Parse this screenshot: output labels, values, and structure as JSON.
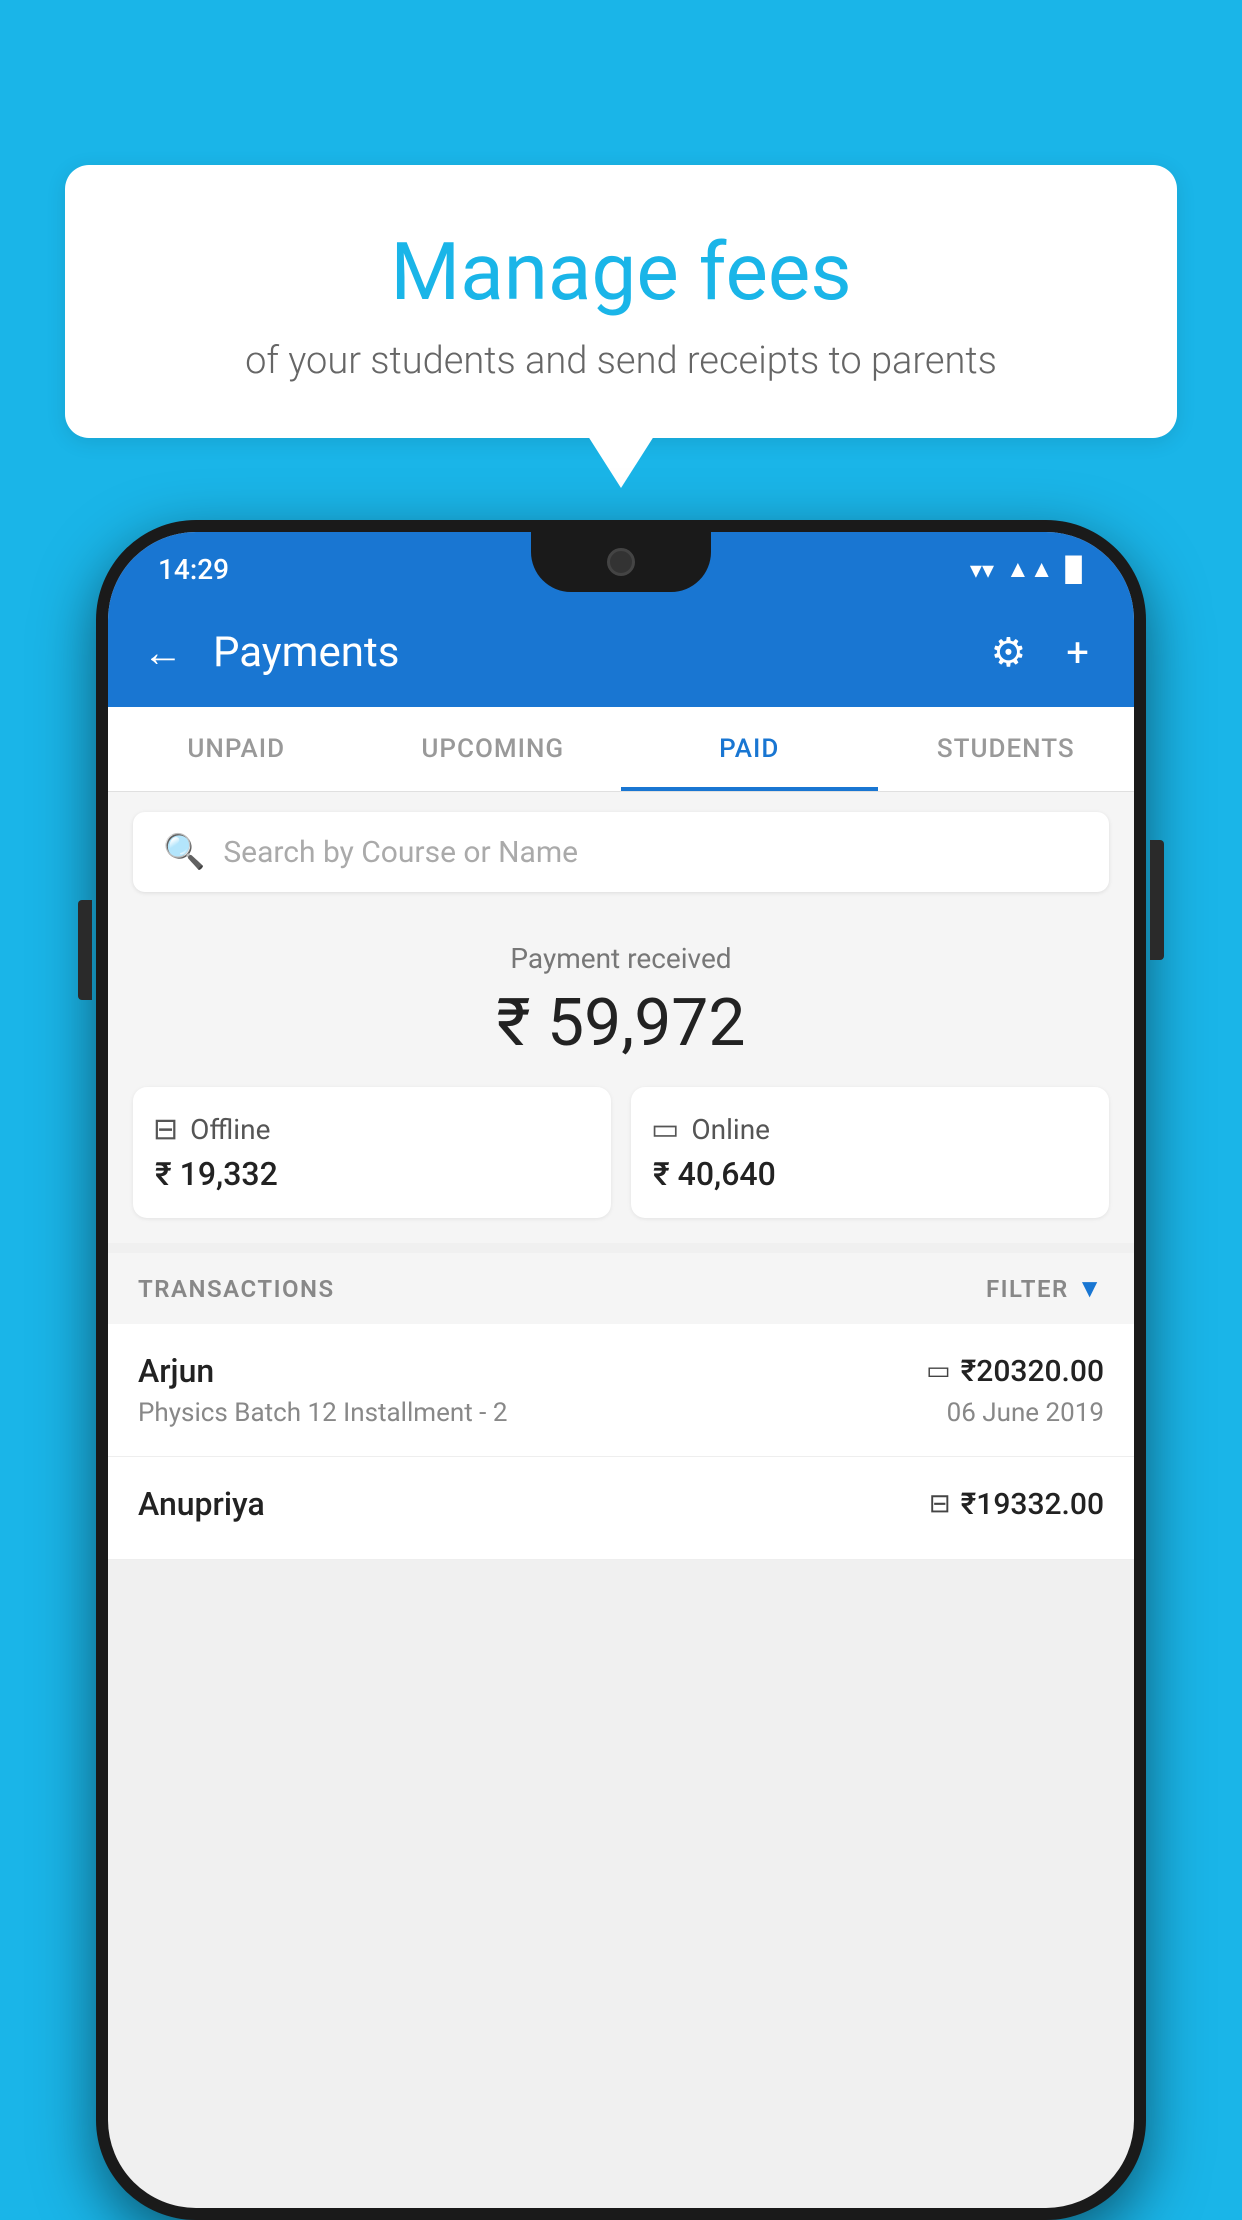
{
  "background_color": "#1ab5e8",
  "bubble": {
    "title": "Manage fees",
    "subtitle": "of your students and send receipts to parents"
  },
  "phone": {
    "status_bar": {
      "time": "14:29",
      "wifi": "▲",
      "signal": "▲",
      "battery": "▉"
    },
    "app_bar": {
      "title": "Payments",
      "back_label": "←",
      "gear_label": "⚙",
      "plus_label": "+"
    },
    "tabs": [
      {
        "label": "UNPAID",
        "active": false
      },
      {
        "label": "UPCOMING",
        "active": false
      },
      {
        "label": "PAID",
        "active": true
      },
      {
        "label": "STUDENTS",
        "active": false
      }
    ],
    "search": {
      "placeholder": "Search by Course or Name"
    },
    "payment_summary": {
      "label": "Payment received",
      "total": "₹ 59,972",
      "offline_label": "Offline",
      "offline_amount": "₹ 19,332",
      "online_label": "Online",
      "online_amount": "₹ 40,640"
    },
    "transactions_header": {
      "label": "TRANSACTIONS",
      "filter_label": "FILTER"
    },
    "transactions": [
      {
        "name": "Arjun",
        "amount": "₹20320.00",
        "course": "Physics Batch 12 Installment - 2",
        "date": "06 June 2019",
        "payment_type": "card"
      },
      {
        "name": "Anupriya",
        "amount": "₹19332.00",
        "course": "",
        "date": "",
        "payment_type": "offline"
      }
    ]
  }
}
